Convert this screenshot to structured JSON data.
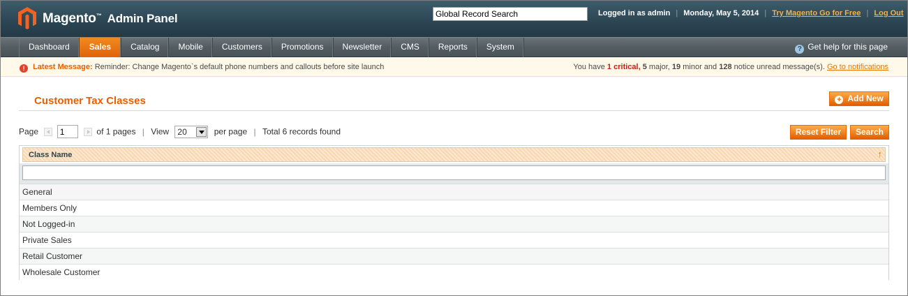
{
  "header": {
    "brand": "Magento",
    "trademark": "™",
    "subtitle": "Admin Panel",
    "global_search_value": "Global Record Search",
    "logged_in": "Logged in as admin",
    "date": "Monday, May 5, 2014",
    "try_link": "Try Magento Go for Free",
    "logout_link": "Log Out",
    "separator": "|"
  },
  "nav": {
    "items": [
      {
        "label": "Dashboard"
      },
      {
        "label": "Sales"
      },
      {
        "label": "Catalog"
      },
      {
        "label": "Mobile"
      },
      {
        "label": "Customers"
      },
      {
        "label": "Promotions"
      },
      {
        "label": "Newsletter"
      },
      {
        "label": "CMS"
      },
      {
        "label": "Reports"
      },
      {
        "label": "System"
      }
    ],
    "active": "Sales",
    "help_icon": "?",
    "help_label": "Get help for this page"
  },
  "notice": {
    "icon": "!",
    "latest_label": "Latest Message:",
    "message": "Reminder: Change Magento`s default phone numbers and callouts before site launch",
    "you_have": "You have",
    "critical_count": "1",
    "critical_label": "critical,",
    "major_count": "5",
    "major_label": "major,",
    "minor_count": "19",
    "minor_label": "minor and",
    "notice_count": "128",
    "notice_label": "notice unread message(s).",
    "go_link": "Go to notifications"
  },
  "page": {
    "title": "Customer Tax Classes",
    "add_new_label": "Add New",
    "add_icon": "+"
  },
  "pager": {
    "page_label": "Page",
    "page_value": "1",
    "of_pages": "of 1 pages",
    "view_label": "View",
    "view_value": "20",
    "per_page": "per page",
    "total": "Total 6 records found",
    "separator": "|",
    "reset_filter_label": "Reset Filter",
    "search_label": "Search"
  },
  "grid": {
    "column_header": "Class Name",
    "sort_icon": "↑",
    "filter_value": "",
    "rows": [
      {
        "name": "General"
      },
      {
        "name": "Members Only"
      },
      {
        "name": "Not Logged-in"
      },
      {
        "name": "Private Sales"
      },
      {
        "name": "Retail Customer"
      },
      {
        "name": "Wholesale Customer"
      }
    ]
  },
  "colors": {
    "accent_orange": "#eb5e00",
    "header_bg": "#2c4654",
    "nav_bg": "#545d62",
    "notice_bg": "#fff9e9",
    "critical_red": "#d11d12"
  }
}
